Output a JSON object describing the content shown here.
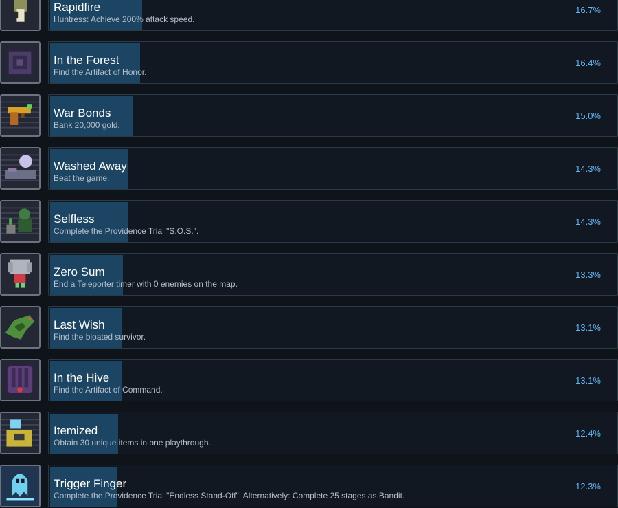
{
  "achievements": [
    {
      "title": "Rapidfire",
      "description": "Huntress: Achieve 200% attack speed.",
      "percent": "16.7%",
      "percent_value": 16.7,
      "icon": "huntress-bow-icon",
      "icon_color": "#8b8f5a"
    },
    {
      "title": "In the Forest",
      "description": "Find the Artifact of Honor.",
      "percent": "16.4%",
      "percent_value": 16.4,
      "icon": "artifact-honor-icon",
      "icon_color": "#4a3e66"
    },
    {
      "title": "War Bonds",
      "description": "Bank 20,000 gold.",
      "percent": "15.0%",
      "percent_value": 15.0,
      "icon": "gold-pistol-icon",
      "icon_color": "#d9a128"
    },
    {
      "title": "Washed Away",
      "description": "Beat the game.",
      "percent": "14.3%",
      "percent_value": 14.3,
      "icon": "washed-away-icon",
      "icon_color": "#6b6f88"
    },
    {
      "title": "Selfless",
      "description": "Complete the Providence Trial \"S.O.S.\".",
      "percent": "14.3%",
      "percent_value": 14.3,
      "icon": "selfless-robot-icon",
      "icon_color": "#3f7b42"
    },
    {
      "title": "Zero Sum",
      "description": "End a Teleporter timer with 0 enemies on the map.",
      "percent": "13.3%",
      "percent_value": 13.3,
      "icon": "zero-sum-mech-icon",
      "icon_color": "#b0b4bd"
    },
    {
      "title": "Last Wish",
      "description": "Find the bloated survivor.",
      "percent": "13.1%",
      "percent_value": 13.1,
      "icon": "last-wish-creature-icon",
      "icon_color": "#4f8f3c"
    },
    {
      "title": "In the Hive",
      "description": "Find the Artifact of Command.",
      "percent": "13.1%",
      "percent_value": 13.1,
      "icon": "artifact-command-icon",
      "icon_color": "#5a3f78"
    },
    {
      "title": "Itemized",
      "description": "Obtain 30 unique items in one playthrough.",
      "percent": "12.4%",
      "percent_value": 12.4,
      "icon": "itemized-survivor-icon",
      "icon_color": "#c9b43a"
    },
    {
      "title": "Trigger Finger",
      "description": "Complete the Providence Trial \"Endless Stand-Off\". Alternatively: Complete 25 stages as Bandit.",
      "percent": "12.3%",
      "percent_value": 12.3,
      "icon": "trigger-finger-ghost-icon",
      "icon_color": "#6fd0ef"
    }
  ]
}
